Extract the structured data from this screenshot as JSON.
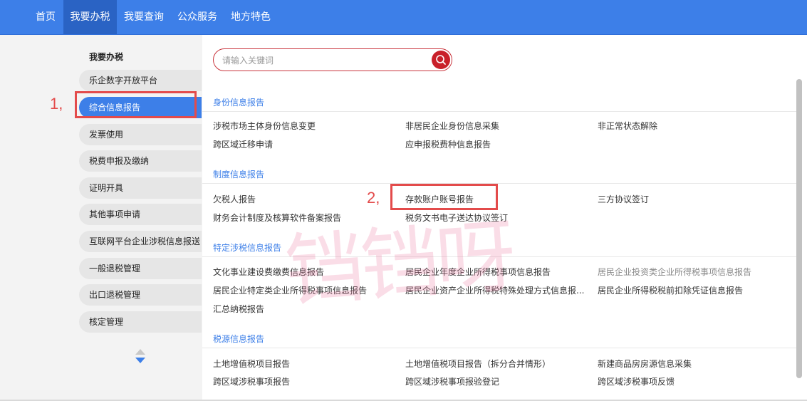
{
  "top_nav": {
    "items": [
      {
        "label": "首页"
      },
      {
        "label": "我要办税"
      },
      {
        "label": "我要查询"
      },
      {
        "label": "公众服务"
      },
      {
        "label": "地方特色"
      }
    ],
    "active_index": 1
  },
  "sidebar": {
    "title": "我要办税",
    "items": [
      {
        "label": "乐企数字开放平台"
      },
      {
        "label": "综合信息报告"
      },
      {
        "label": "发票使用"
      },
      {
        "label": "税费申报及缴纳"
      },
      {
        "label": "证明开具"
      },
      {
        "label": "其他事项申请"
      },
      {
        "label": "互联网平台企业涉税信息报送"
      },
      {
        "label": "一般退税管理"
      },
      {
        "label": "出口退税管理"
      },
      {
        "label": "核定管理"
      }
    ],
    "active_index": 1
  },
  "search": {
    "placeholder": "请输入关键词",
    "icon": "search-icon"
  },
  "sections": [
    {
      "title": "身份信息报告",
      "links": [
        "涉税市场主体身份信息变更",
        "非居民企业身份信息采集",
        "非正常状态解除",
        "跨区域迁移申请",
        "应申报税费种信息报告"
      ]
    },
    {
      "title": "制度信息报告",
      "links": [
        "欠税人报告",
        "存款账户账号报告",
        "三方协议签订",
        "财务会计制度及核算软件备案报告",
        "税务文书电子送达协议签订"
      ]
    },
    {
      "title": "特定涉税信息报告",
      "links": [
        "文化事业建设费缴费信息报告",
        "居民企业年度企业所得税事项信息报告",
        "居民企业投资类企业所得税事项信息报告",
        "居民企业特定类企业所得税事项信息报告",
        "居民企业资产企业所得税特殊处理方式信息报...",
        "居民企业所得税税前扣除凭证信息报告",
        "汇总纳税报告"
      ]
    },
    {
      "title": "税源信息报告",
      "links": [
        "土地增值税项目报告",
        "土地增值税项目报告（拆分合并情形）",
        "新建商品房房源信息采集",
        "跨区域涉税事项报告",
        "跨区域涉税事项报验登记",
        "跨区域涉税事项反馈"
      ]
    }
  ],
  "annotations": {
    "label_1": "1,",
    "label_2": "2,",
    "color": "#e34b4b"
  },
  "watermark": "铛铛呀",
  "colors": {
    "nav_bg": "#3d7fe8",
    "nav_active": "#2a63c4",
    "accent": "#3d7fe8",
    "search_border": "#c9353d"
  }
}
